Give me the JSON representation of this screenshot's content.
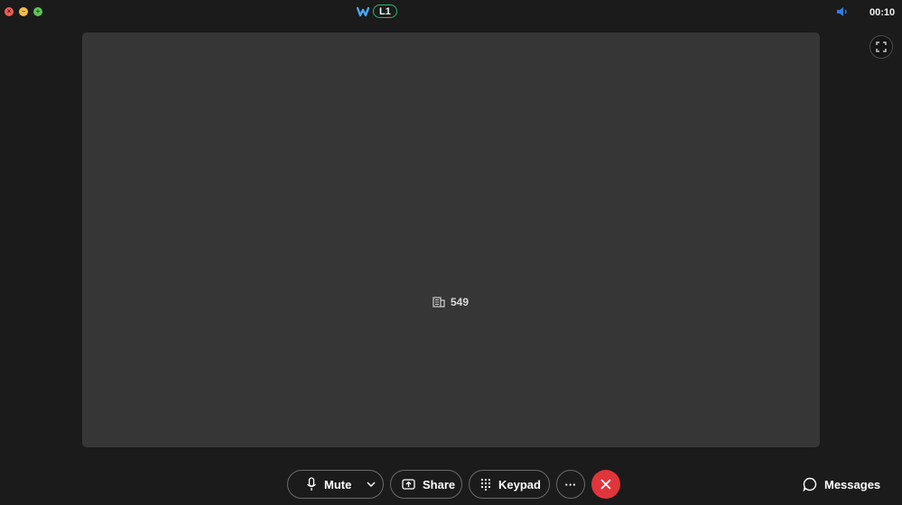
{
  "titlebar": {
    "line_label": "L1",
    "timer": "00:10"
  },
  "stage": {
    "participant_label": "549"
  },
  "controls": {
    "mute_label": "Mute",
    "share_label": "Share",
    "keypad_label": "Keypad",
    "more_label": "···"
  },
  "messages": {
    "label": "Messages"
  },
  "colors": {
    "end_call": "#e0353b",
    "line_badge": "#2fb56a",
    "volume": "#2f7de1",
    "background": "#1b1b1b",
    "stage": "#363636"
  }
}
